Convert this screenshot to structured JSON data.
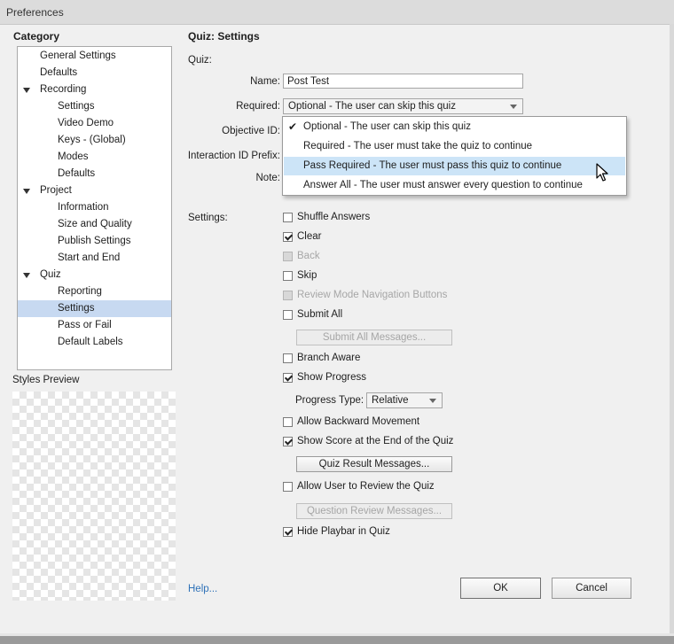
{
  "window": {
    "title": "Preferences"
  },
  "category": {
    "header": "Category",
    "items": [
      {
        "label": "General Settings",
        "level": 1,
        "expander": false,
        "selected": false
      },
      {
        "label": "Defaults",
        "level": 1,
        "expander": false,
        "selected": false
      },
      {
        "label": "Recording",
        "level": 1,
        "expander": true,
        "selected": false
      },
      {
        "label": "Settings",
        "level": 2,
        "expander": false,
        "selected": false
      },
      {
        "label": "Video Demo",
        "level": 2,
        "expander": false,
        "selected": false
      },
      {
        "label": "Keys - (Global)",
        "level": 2,
        "expander": false,
        "selected": false
      },
      {
        "label": "Modes",
        "level": 2,
        "expander": false,
        "selected": false
      },
      {
        "label": "Defaults",
        "level": 2,
        "expander": false,
        "selected": false
      },
      {
        "label": "Project",
        "level": 1,
        "expander": true,
        "selected": false
      },
      {
        "label": "Information",
        "level": 2,
        "expander": false,
        "selected": false
      },
      {
        "label": "Size and Quality",
        "level": 2,
        "expander": false,
        "selected": false
      },
      {
        "label": "Publish Settings",
        "level": 2,
        "expander": false,
        "selected": false
      },
      {
        "label": "Start and End",
        "level": 2,
        "expander": false,
        "selected": false
      },
      {
        "label": "Quiz",
        "level": 1,
        "expander": true,
        "selected": false
      },
      {
        "label": "Reporting",
        "level": 2,
        "expander": false,
        "selected": false
      },
      {
        "label": "Settings",
        "level": 2,
        "expander": false,
        "selected": true
      },
      {
        "label": "Pass or Fail",
        "level": 2,
        "expander": false,
        "selected": false
      },
      {
        "label": "Default Labels",
        "level": 2,
        "expander": false,
        "selected": false
      }
    ]
  },
  "styles_preview": {
    "label": "Styles Preview"
  },
  "panel": {
    "title": "Quiz: Settings",
    "quiz_section": "Quiz:",
    "name_label": "Name:",
    "name_value": "Post Test",
    "required_label": "Required:",
    "required_value": "Optional - The user can skip this quiz",
    "objective_label": "Objective ID:",
    "interaction_label": "Interaction ID Prefix:",
    "note_label": "Note:",
    "settings_label": "Settings:"
  },
  "required_dropdown": {
    "options": [
      {
        "label": "Optional - The user can skip this quiz",
        "checked": true,
        "highlighted": false
      },
      {
        "label": "Required - The user must take the quiz to continue",
        "checked": false,
        "highlighted": false
      },
      {
        "label": "Pass Required - The user must pass this quiz to continue",
        "checked": false,
        "highlighted": true
      },
      {
        "label": "Answer All - The user must answer every question to continue",
        "checked": false,
        "highlighted": false
      }
    ],
    "checkmark": "✔"
  },
  "settings": {
    "shuffle": {
      "label": "Shuffle Answers",
      "checked": false,
      "disabled": false
    },
    "clear": {
      "label": "Clear",
      "checked": true,
      "disabled": false
    },
    "back": {
      "label": "Back",
      "checked": false,
      "disabled": true
    },
    "skip": {
      "label": "Skip",
      "checked": false,
      "disabled": false
    },
    "review_nav": {
      "label": "Review Mode Navigation Buttons",
      "checked": false,
      "disabled": true
    },
    "submit_all": {
      "label": "Submit All",
      "checked": false,
      "disabled": false
    },
    "submit_all_msgs": "Submit All Messages...",
    "branch_aware": {
      "label": "Branch Aware",
      "checked": false,
      "disabled": false
    },
    "show_progress": {
      "label": "Show Progress",
      "checked": true,
      "disabled": false
    },
    "progress_type_label": "Progress Type:",
    "progress_type_value": "Relative",
    "allow_backward": {
      "label": "Allow Backward Movement",
      "checked": false,
      "disabled": false
    },
    "show_score": {
      "label": "Show Score at the End of the Quiz",
      "checked": true,
      "disabled": false
    },
    "quiz_result_msgs": "Quiz Result Messages...",
    "allow_review": {
      "label": "Allow User to Review the Quiz",
      "checked": false,
      "disabled": false
    },
    "question_review_msgs": "Question Review Messages...",
    "hide_playbar": {
      "label": "Hide Playbar in Quiz",
      "checked": true,
      "disabled": false
    }
  },
  "footer": {
    "help": "Help...",
    "ok": "OK",
    "cancel": "Cancel"
  },
  "icons": {
    "expand": "triangle-down-icon",
    "cursor": "mouse-pointer-icon"
  }
}
